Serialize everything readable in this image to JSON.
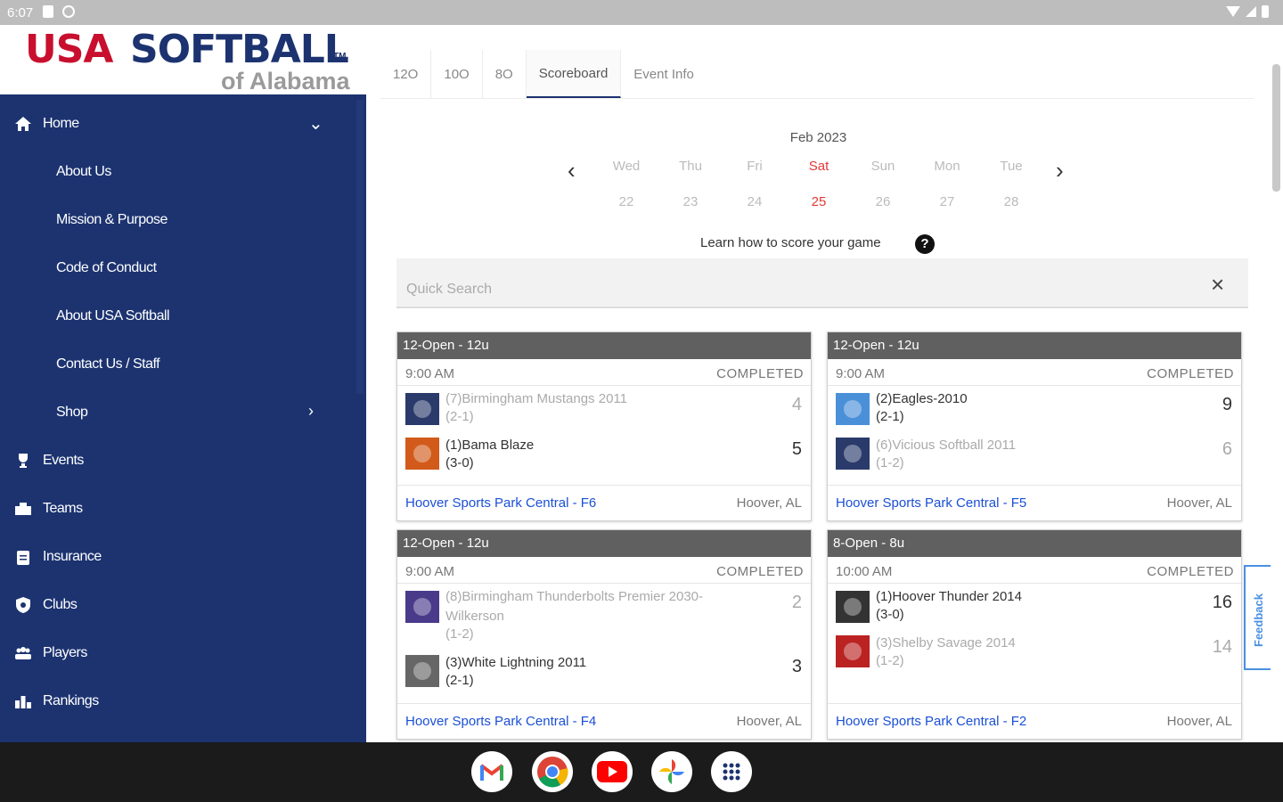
{
  "status_bar": {
    "time": "6:07"
  },
  "logo": {
    "brand_usa": "USA",
    "brand_softball": "SOFTBALL",
    "tm": "TM",
    "sub": "of Alabama"
  },
  "nav": {
    "home": "Home",
    "about_us": "About Us",
    "mission": "Mission & Purpose",
    "code_of_conduct": "Code of Conduct",
    "about_usa_softball": "About USA Softball",
    "contact": "Contact Us / Staff",
    "shop": "Shop",
    "events": "Events",
    "teams": "Teams",
    "insurance": "Insurance",
    "clubs": "Clubs",
    "players": "Players",
    "rankings": "Rankings"
  },
  "tabs": [
    "12O",
    "10O",
    "8O",
    "Scoreboard",
    "Event Info"
  ],
  "calendar": {
    "month": "Feb 2023",
    "days": [
      {
        "dow": "Wed",
        "num": "22"
      },
      {
        "dow": "Thu",
        "num": "23"
      },
      {
        "dow": "Fri",
        "num": "24"
      },
      {
        "dow": "Sat",
        "num": "25"
      },
      {
        "dow": "Sun",
        "num": "26"
      },
      {
        "dow": "Mon",
        "num": "27"
      },
      {
        "dow": "Tue",
        "num": "28"
      }
    ],
    "selected_index": 3
  },
  "learn_text": "Learn how to score your game",
  "search": {
    "placeholder": "Quick Search"
  },
  "games": [
    {
      "division": "12-Open - 12u",
      "time": "9:00 AM",
      "status": "COMPLETED",
      "team1": {
        "name": "(7)Birmingham Mustangs 2011",
        "record": "(2-1)",
        "score": "4"
      },
      "team2": {
        "name": "(1)Bama Blaze",
        "record": "(3-0)",
        "score": "5"
      },
      "venue": "Hoover Sports Park Central - F6",
      "city": "Hoover, AL"
    },
    {
      "division": "12-Open - 12u",
      "time": "9:00 AM",
      "status": "COMPLETED",
      "team1": {
        "name": "(2)Eagles-2010",
        "record": "(2-1)",
        "score": "9"
      },
      "team2": {
        "name": "(6)Vicious Softball 2011",
        "record": "(1-2)",
        "score": "6"
      },
      "venue": "Hoover Sports Park Central - F5",
      "city": "Hoover, AL"
    },
    {
      "division": "12-Open - 12u",
      "time": "9:00 AM",
      "status": "COMPLETED",
      "team1": {
        "name": "(8)Birmingham Thunderbolts Premier 2030-Wilkerson",
        "record": "(1-2)",
        "score": "2"
      },
      "team2": {
        "name": "(3)White Lightning 2011",
        "record": "(2-1)",
        "score": "3"
      },
      "venue": "Hoover Sports Park Central - F4",
      "city": "Hoover, AL"
    },
    {
      "division": "8-Open - 8u",
      "time": "10:00 AM",
      "status": "COMPLETED",
      "team1": {
        "name": "(1)Hoover Thunder 2014",
        "record": "(3-0)",
        "score": "16"
      },
      "team2": {
        "name": "(3)Shelby Savage 2014",
        "record": "(1-2)",
        "score": "14"
      },
      "venue": "Hoover Sports Park Central - F2",
      "city": "Hoover, AL"
    }
  ],
  "feedback": "Feedback",
  "taskbar_apps": [
    "gmail",
    "chrome",
    "youtube",
    "photos",
    "app-launcher"
  ]
}
